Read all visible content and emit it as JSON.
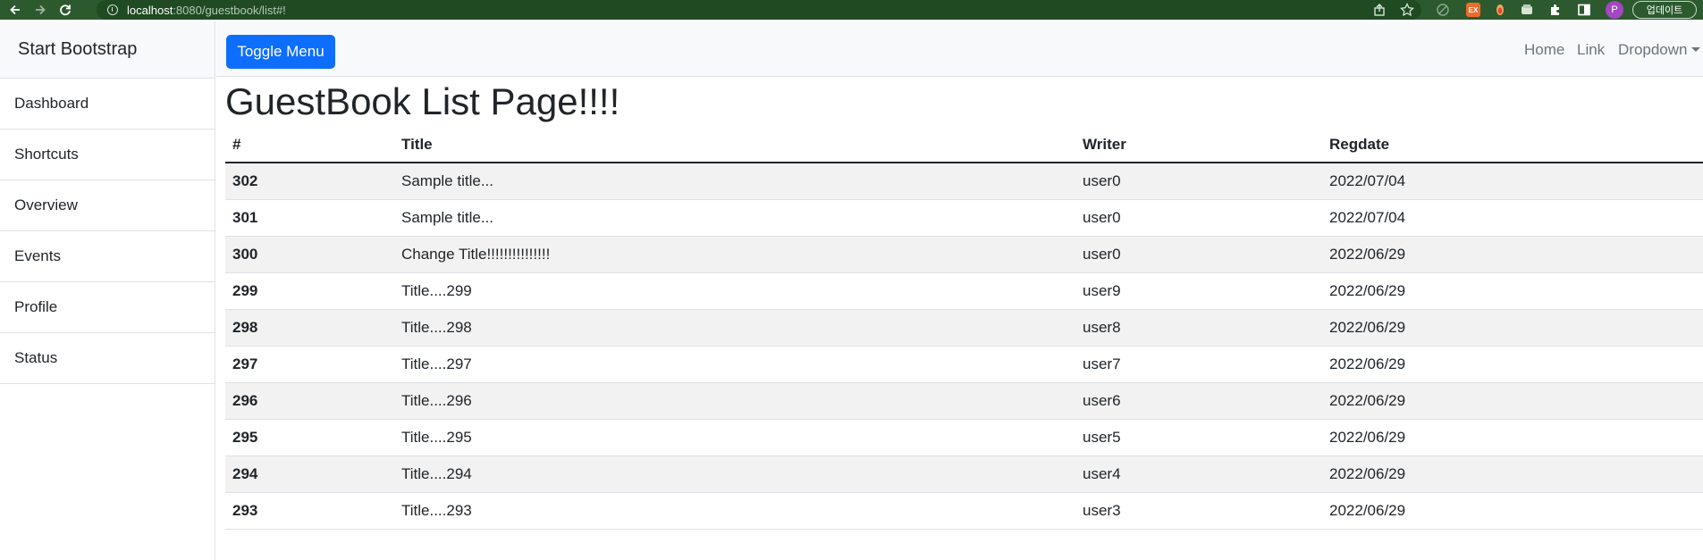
{
  "browser": {
    "url_host": "localhost",
    "url_path": ":8080/guestbook/list#!",
    "profile_initial": "P",
    "update_label": "업데이트",
    "icons": [
      "back-icon",
      "forward-icon",
      "reload-icon",
      "info-icon",
      "share-icon",
      "star-icon",
      "extension-icon",
      "puzzle-icon",
      "sidebar-icon",
      "menu-icon"
    ]
  },
  "sidebar": {
    "heading": "Start Bootstrap",
    "items": [
      {
        "label": "Dashboard"
      },
      {
        "label": "Shortcuts"
      },
      {
        "label": "Overview"
      },
      {
        "label": "Events"
      },
      {
        "label": "Profile"
      },
      {
        "label": "Status"
      }
    ]
  },
  "navbar": {
    "toggle_label": "Toggle Menu",
    "links": [
      {
        "label": "Home"
      },
      {
        "label": "Link"
      },
      {
        "label": "Dropdown"
      }
    ]
  },
  "main": {
    "title": "GuestBook List Page!!!!",
    "columns": [
      "#",
      "Title",
      "Writer",
      "Regdate"
    ],
    "rows": [
      {
        "num": "302",
        "title": "Sample title...",
        "writer": "user0",
        "regdate": "2022/07/04"
      },
      {
        "num": "301",
        "title": "Sample title...",
        "writer": "user0",
        "regdate": "2022/07/04"
      },
      {
        "num": "300",
        "title": "Change Title!!!!!!!!!!!!!!!",
        "writer": "user0",
        "regdate": "2022/06/29"
      },
      {
        "num": "299",
        "title": "Title....299",
        "writer": "user9",
        "regdate": "2022/06/29"
      },
      {
        "num": "298",
        "title": "Title....298",
        "writer": "user8",
        "regdate": "2022/06/29"
      },
      {
        "num": "297",
        "title": "Title....297",
        "writer": "user7",
        "regdate": "2022/06/29"
      },
      {
        "num": "296",
        "title": "Title....296",
        "writer": "user6",
        "regdate": "2022/06/29"
      },
      {
        "num": "295",
        "title": "Title....295",
        "writer": "user5",
        "regdate": "2022/06/29"
      },
      {
        "num": "294",
        "title": "Title....294",
        "writer": "user4",
        "regdate": "2022/06/29"
      },
      {
        "num": "293",
        "title": "Title....293",
        "writer": "user3",
        "regdate": "2022/06/29"
      }
    ]
  },
  "colors": {
    "chrome": "#2c5a2e",
    "primary_button": "#0d6efd",
    "stripe": "#f2f2f2"
  }
}
